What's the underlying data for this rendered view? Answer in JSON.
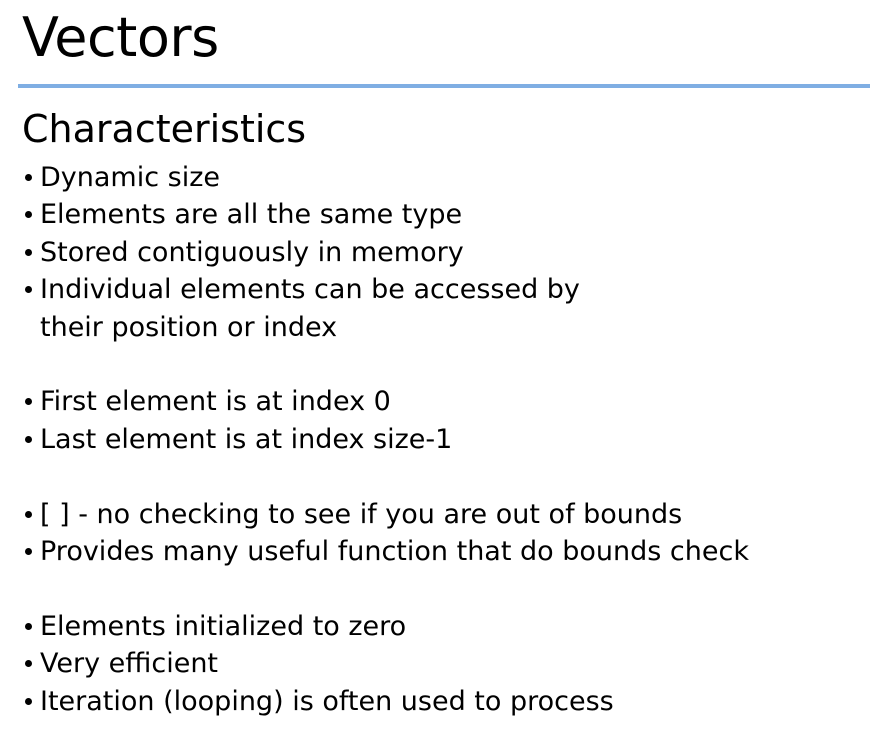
{
  "slide": {
    "title": "Vectors",
    "subtitle": "Characteristics",
    "rule_color": "#7faee3",
    "groups": [
      {
        "items": [
          {
            "text": "Dynamic size"
          },
          {
            "text": "Elements are all the same type"
          },
          {
            "text": "Stored contiguously in memory"
          },
          {
            "text": "Individual elements can be accessed by",
            "continuation": "their position or index"
          }
        ]
      },
      {
        "items": [
          {
            "text": "First element is at index 0"
          },
          {
            "text": "Last element is at index size-1"
          }
        ]
      },
      {
        "items": [
          {
            "text": "[ ] - no checking to see if you are out of bounds"
          },
          {
            "text": "Provides many useful function that do bounds check"
          }
        ]
      },
      {
        "items": [
          {
            "text": "Elements initialized to zero"
          },
          {
            "text": "Very efficient"
          },
          {
            "text": "Iteration (looping) is often used to process"
          }
        ]
      }
    ]
  }
}
